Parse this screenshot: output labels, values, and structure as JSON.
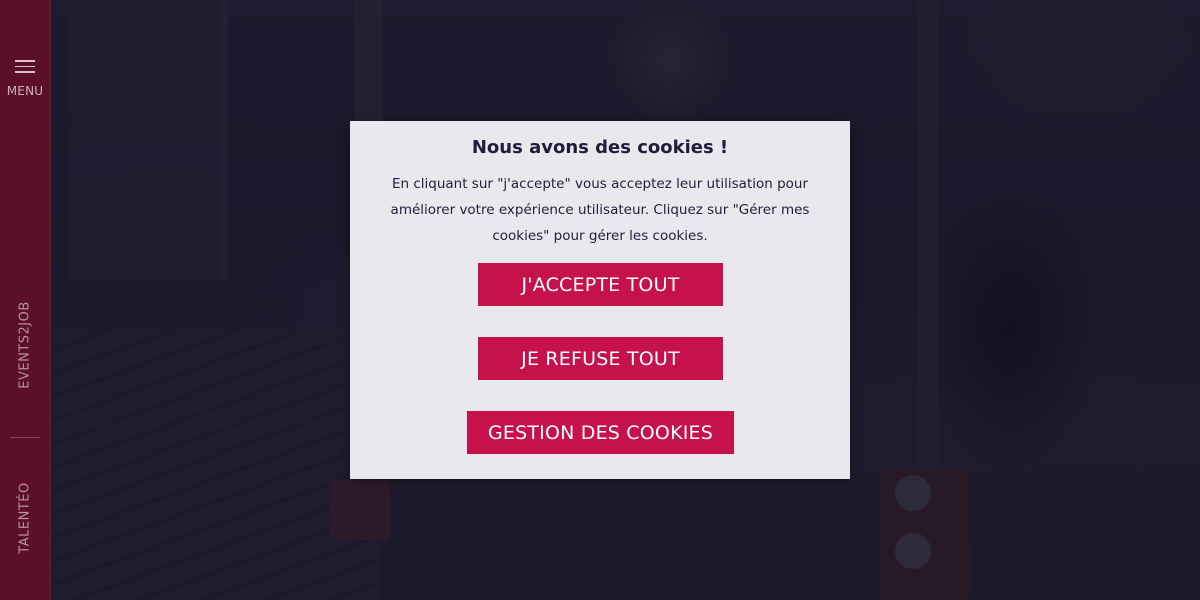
{
  "sidebar": {
    "menu_label": "MENU",
    "links": [
      {
        "label": "EVENTS2JOB"
      },
      {
        "label": "TALENTÉO"
      }
    ]
  },
  "cookie_modal": {
    "title": "Nous avons des cookies !",
    "text": "En cliquant sur \"j'accepte\" vous acceptez leur utilisation pour améliorer votre expérience utilisateur. Cliquez sur \"Gérer mes cookies\" pour gérer les cookies.",
    "accept_label": "J'ACCEPTE TOUT",
    "refuse_label": "JE REFUSE TOUT",
    "manage_label": "GESTION DES COOKIES"
  },
  "colors": {
    "sidebar_bg": "#5b1027",
    "button_bg": "#c5124a",
    "modal_bg": "#e9e8ec",
    "title_text": "#1e1d3a"
  }
}
